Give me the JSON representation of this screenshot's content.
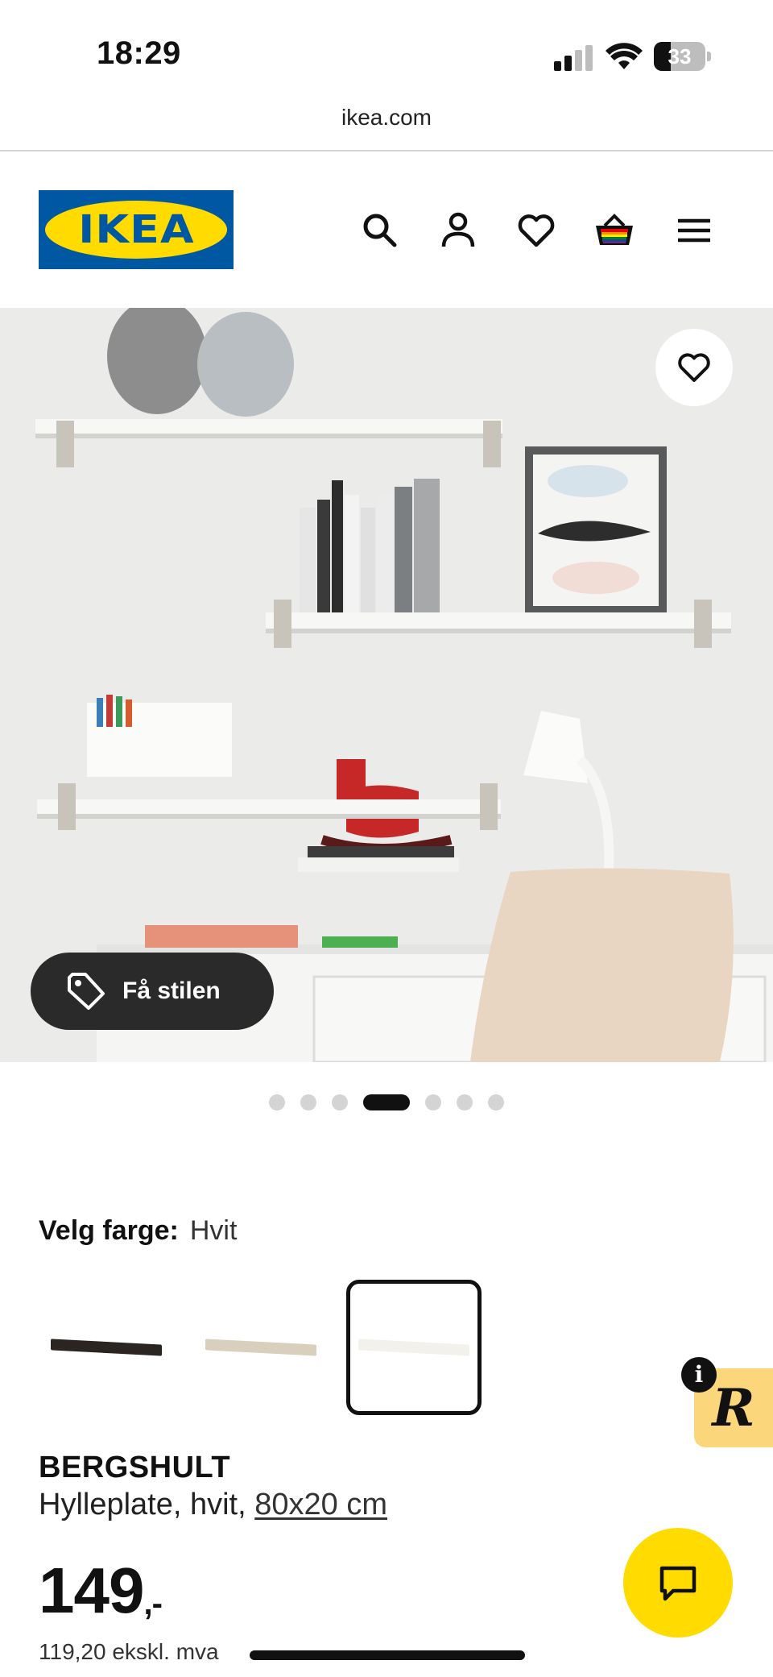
{
  "status_bar": {
    "time": "18:29",
    "battery": "33",
    "battery_level": 0.33
  },
  "browser": {
    "url": "ikea.com"
  },
  "header": {
    "logo_text": "IKEA",
    "icons": [
      "search-icon",
      "profile-icon",
      "heart-icon",
      "basket-icon",
      "menu-icon"
    ]
  },
  "hero": {
    "style_button_label": "Få stilen",
    "image_count": 7,
    "active_image_index": 3
  },
  "color_picker": {
    "label": "Velg farge:",
    "selected": "Hvit",
    "options": [
      {
        "name": "black-brown",
        "color": "#2b2522"
      },
      {
        "name": "beige",
        "color": "#d8cfbd"
      },
      {
        "name": "white",
        "color": "#f3f1ec",
        "selected": true
      }
    ]
  },
  "product": {
    "name": "BERGSHULT",
    "description": "Hylleplate, hvit,",
    "size_link": "80x20 cm",
    "price": "149",
    "price_suffix": ",-",
    "price_ex_vat": "119,20 ekskl. mva"
  },
  "colors": {
    "brand_blue": "#0058a3",
    "brand_yellow": "#ffdb00"
  }
}
